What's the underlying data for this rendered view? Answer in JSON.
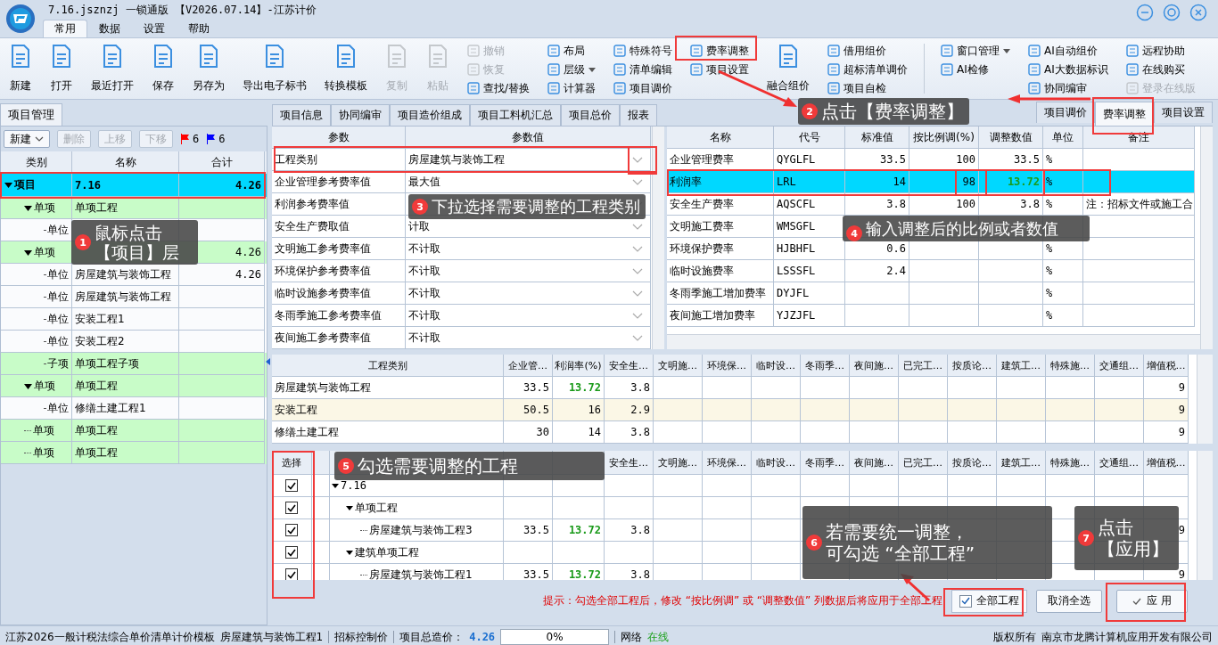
{
  "window": {
    "title": "7.16.jsznzj 一锁通版 【V2026.07.14】-江苏计价"
  },
  "menu_tabs": [
    {
      "label": "常用",
      "selected": true
    },
    {
      "label": "数据",
      "selected": false
    },
    {
      "label": "设置",
      "selected": false
    },
    {
      "label": "帮助",
      "selected": false
    }
  ],
  "ribbon": {
    "sections": [
      [
        {
          "kind": "large",
          "items": [
            {
              "label": "新建",
              "disabled": false
            },
            {
              "label": "打开",
              "disabled": false
            },
            {
              "label": "最近打开",
              "disabled": false
            },
            {
              "label": "保存",
              "disabled": false
            },
            {
              "label": "另存为",
              "disabled": false
            },
            {
              "label": "导出电子标书",
              "disabled": false
            },
            {
              "label": "转换模板",
              "disabled": false
            },
            {
              "label": "复制",
              "disabled": true
            },
            {
              "label": "粘贴",
              "disabled": true
            }
          ]
        },
        {
          "kind": "small",
          "items": [
            {
              "label": "撤销",
              "disabled": true
            },
            {
              "label": "恢复",
              "disabled": true
            },
            {
              "label": "查找/替换",
              "disabled": false
            }
          ]
        },
        {
          "kind": "small",
          "items": [
            {
              "label": "布局",
              "disabled": false
            },
            {
              "label": "层级",
              "disabled": false,
              "dropdown": true
            },
            {
              "label": "计算器",
              "disabled": false
            }
          ]
        },
        {
          "kind": "small",
          "items": [
            {
              "label": "特殊符号",
              "disabled": false
            },
            {
              "label": "清单编辑",
              "disabled": false
            },
            {
              "label": "项目调价",
              "disabled": false
            }
          ]
        },
        {
          "kind": "small",
          "items": [
            {
              "label": "费率调整",
              "disabled": false
            },
            {
              "label": "项目设置",
              "disabled": false
            }
          ]
        },
        {
          "kind": "large",
          "items": [
            {
              "label": "融合组价",
              "disabled": false
            }
          ]
        },
        {
          "kind": "small",
          "items": [
            {
              "label": "借用组价",
              "disabled": false
            },
            {
              "label": "超标清单调价",
              "disabled": false
            },
            {
              "label": "项目自检",
              "disabled": false
            }
          ]
        }
      ],
      [
        {
          "kind": "small",
          "items": [
            {
              "label": "窗口管理",
              "disabled": false,
              "dropdown": true
            },
            {
              "label": "AI检修",
              "disabled": false
            }
          ]
        },
        {
          "kind": "small",
          "items": [
            {
              "label": "AI自动组价",
              "disabled": false
            },
            {
              "label": "AI大数据标识",
              "disabled": false
            },
            {
              "label": "协同编审",
              "disabled": false
            }
          ]
        },
        {
          "kind": "small",
          "items": [
            {
              "label": "远程协助",
              "disabled": false
            },
            {
              "label": "在线购买",
              "disabled": false
            },
            {
              "label": "登录在线版",
              "disabled": true
            }
          ]
        }
      ]
    ]
  },
  "project_panel": {
    "tab": "项目管理",
    "toolbar": [
      {
        "label": "新建",
        "disabled": false,
        "dropdown": true
      },
      {
        "label": "删除",
        "disabled": true
      },
      {
        "label": "上移",
        "disabled": true
      },
      {
        "label": "下移",
        "disabled": true
      }
    ],
    "flags": [
      {
        "color": "#ff0000",
        "count": "6"
      },
      {
        "color": "#0000ff",
        "count": "6"
      }
    ],
    "columns": [
      "类别",
      "名称",
      "合计"
    ],
    "tree": [
      {
        "kind": "project",
        "category": "项目",
        "name": "7.16",
        "total": "4.26",
        "selected": true,
        "expanded": true,
        "children": [
          {
            "kind": "section",
            "category": "单项",
            "name": "单项工程",
            "selected": false,
            "expanded": true,
            "children": [
              {
                "kind": "unit",
                "category": "单位",
                "selected": false
              }
            ]
          },
          {
            "kind": "section",
            "category": "单项",
            "total": "4.26",
            "selected": false,
            "expanded": true,
            "children": [
              {
                "kind": "unit",
                "category": "单位",
                "name": "房屋建筑与装饰工程",
                "total": "4.26",
                "selected": false
              },
              {
                "kind": "unit",
                "category": "单位",
                "name": "房屋建筑与装饰工程",
                "selected": false
              },
              {
                "kind": "unit",
                "category": "单位",
                "name": "安装工程1",
                "selected": false
              },
              {
                "kind": "unit",
                "category": "单位",
                "name": "安装工程2",
                "selected": false
              },
              {
                "kind": "section",
                "category": "子项",
                "name": "单项工程子项",
                "selected": false
              }
            ]
          },
          {
            "kind": "section",
            "category": "单项",
            "name": "单项工程",
            "selected": false,
            "expanded": true,
            "children": [
              {
                "kind": "unit",
                "category": "单位",
                "name": "修缮土建工程1",
                "selected": false
              }
            ]
          },
          {
            "kind": "section",
            "category": "单项",
            "name": "单项工程",
            "selected": false
          },
          {
            "kind": "section",
            "category": "单项",
            "name": "单项工程",
            "selected": false
          }
        ]
      }
    ]
  },
  "detail_tabs": [
    {
      "label": "项目信息",
      "selected": false
    },
    {
      "label": "协同编审",
      "selected": false
    },
    {
      "label": "项目造价组成",
      "selected": false
    },
    {
      "label": "项目工料机汇总",
      "selected": false
    },
    {
      "label": "项目总价",
      "selected": false
    },
    {
      "label": "报表",
      "selected": false
    }
  ],
  "side_tabs": [
    {
      "label": "项目调价",
      "selected": false
    },
    {
      "label": "费率调整",
      "selected": true
    },
    {
      "label": "项目设置",
      "selected": false
    }
  ],
  "param_table": {
    "columns": [
      "参数",
      "参数值"
    ],
    "rows": [
      {
        "param": "工程类别",
        "value": "房屋建筑与装饰工程"
      },
      {
        "param": "企业管理参考费率值",
        "value": "最大值"
      },
      {
        "param": "利润参考费率值"
      },
      {
        "param": "安全生产费取值",
        "value": "计取"
      },
      {
        "param": "文明施工参考费率值",
        "value": "不计取"
      },
      {
        "param": "环境保护参考费率值",
        "value": "不计取"
      },
      {
        "param": "临时设施参考费率值",
        "value": "不计取"
      },
      {
        "param": "冬雨季施工参考费率值",
        "value": "不计取"
      },
      {
        "param": "夜间施工参考费率值",
        "value": "不计取"
      }
    ]
  },
  "rate_table": {
    "columns": [
      "名称",
      "代号",
      "标准值",
      "按比例调(%)",
      "调整数值",
      "单位",
      "备注"
    ],
    "rows": [
      {
        "name": "企业管理费率",
        "code": "QYGLFL",
        "standard": "33.5",
        "ratio": "100",
        "adjusted": "33.5",
        "unit": "%",
        "selected": false,
        "changed": false
      },
      {
        "name": "利润率",
        "code": "LRL",
        "standard": "14",
        "ratio": "98",
        "adjusted": "13.72",
        "unit": "%",
        "selected": true,
        "changed": true
      },
      {
        "name": "安全生产费率",
        "code": "AQSCFL",
        "standard": "3.8",
        "ratio": "100",
        "adjusted": "3.8",
        "unit": "%",
        "note": "注：招标文件或施工合",
        "selected": false,
        "changed": false
      },
      {
        "name": "文明施工费率",
        "code": "WMSGFL",
        "selected": false
      },
      {
        "name": "环境保护费率",
        "code": "HJBHFL",
        "standard": "0.6",
        "unit": "%",
        "selected": false
      },
      {
        "name": "临时设施费率",
        "code": "LSSSFL",
        "standard": "2.4",
        "unit": "%",
        "selected": false
      },
      {
        "name": "冬雨季施工增加费率",
        "code": "DYJFL",
        "unit": "%",
        "selected": false
      },
      {
        "name": "夜间施工增加费率",
        "code": "YJZJFL",
        "unit": "%",
        "selected": false
      }
    ]
  },
  "rates_by_type": {
    "columns": [
      "工程类别",
      "企业管…",
      "利润率(%)",
      "安全生…",
      "文明施…",
      "环境保…",
      "临时设…",
      "冬雨季…",
      "夜间施…",
      "已完工…",
      "按质论…",
      "建筑工…",
      "特殊施…",
      "交通组…",
      "增值税…"
    ],
    "rows": [
      {
        "type": "房屋建筑与装饰工程",
        "management": "33.5",
        "profit": "13.72",
        "safety": "3.8",
        "vat": "9",
        "changed": true,
        "selected": false
      },
      {
        "type": "安装工程",
        "management": "50.5",
        "profit": "16",
        "safety": "2.9",
        "vat": "9",
        "changed": false,
        "selected": true
      },
      {
        "type": "修缮土建工程",
        "management": "30",
        "profit": "14",
        "safety": "3.8",
        "vat": "9",
        "changed": false,
        "selected": false
      }
    ]
  },
  "select_table": {
    "columns": [
      "选择",
      "安全生…",
      "文明施…",
      "环境保…",
      "临时设…",
      "冬雨季…",
      "夜间施…",
      "已完工…",
      "按质论…",
      "建筑工…",
      "特殊施…",
      "交通组…",
      "增值税…"
    ],
    "tree": [
      {
        "label": "7.16",
        "checked": true,
        "expanded": true,
        "children": [
          {
            "label": "单项工程",
            "checked": true,
            "expanded": true,
            "children": [
              {
                "label": "房屋建筑与装饰工程3",
                "checked": true,
                "management": "33.5",
                "profit": "13.72",
                "safety": "3.8",
                "vat": "9",
                "changed": true
              }
            ]
          },
          {
            "label": "建筑单项工程",
            "checked": true,
            "expanded": true,
            "children": [
              {
                "label": "房屋建筑与装饰工程1",
                "checked": true,
                "management": "33.5",
                "profit": "13.72",
                "safety": "3.8",
                "vat": "9",
                "changed": true
              }
            ]
          }
        ]
      }
    ]
  },
  "apply_bar": {
    "hint": "提示：勾选全部工程后，修改 “按比例调” 或 “调整数值” 列数据后将应用于全部工程",
    "all_projects": {
      "label": "全部工程",
      "checked": true
    },
    "buttons": [
      {
        "kind": "plain",
        "label": "取消全选"
      },
      {
        "kind": "apply",
        "label": "应 用"
      }
    ]
  },
  "status_bar": {
    "template": "江苏2026一般计税法综合单价清单计价模板",
    "unit": "房屋建筑与装饰工程1",
    "price_type": "招标控制价",
    "total_label": "项目总造价：",
    "total": "4.26",
    "progress": {
      "level": 0,
      "reading": "0%"
    },
    "network_label": "网络",
    "network_status": "在线",
    "online": true,
    "copyright_label": "版权所有",
    "company": "南京市龙腾计算机应用开发有限公司"
  },
  "callouts": [
    {
      "number": "1",
      "lines": [
        "鼠标点击",
        "【项目】层"
      ]
    },
    {
      "number": "2",
      "lines": [
        "点击【费率调整】"
      ]
    },
    {
      "number": "3",
      "lines": [
        "下拉选择需要调整的工程类别"
      ]
    },
    {
      "number": "4",
      "lines": [
        "输入调整后的比例或者数值"
      ]
    },
    {
      "number": "5",
      "lines": [
        "勾选需要调整的工程"
      ]
    },
    {
      "number": "6",
      "lines": [
        "若需要统一调整，",
        "可勾选 “全部工程”"
      ]
    },
    {
      "number": "7",
      "lines": [
        "点击",
        "【应用】"
      ]
    }
  ]
}
